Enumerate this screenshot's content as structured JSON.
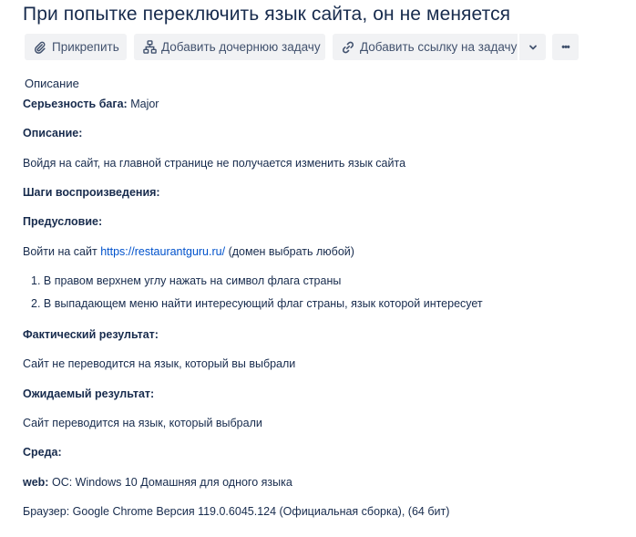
{
  "issue": {
    "title": "При попытке переключить язык сайта, он не меняется"
  },
  "toolbar": {
    "attach_label": "Прикрепить",
    "child_task_label": "Добавить дочернюю задачу",
    "link_task_label": "Добавить ссылку на задачу",
    "more_label": "•••"
  },
  "description": {
    "section_label": "Описание",
    "severity_label": "Серьезность бага:",
    "severity_value": "Major",
    "desc_heading": "Описание:",
    "desc_text": "Войдя на сайт, на главной странице не получается изменить язык сайта",
    "steps_heading": "Шаги воспроизведения:",
    "precondition_heading": "Предусловие:",
    "precondition_prefix": "Войти на сайт",
    "precondition_link": "https://restaurantguru.ru/",
    "precondition_suffix": "(домен выбрать любой)",
    "steps": [
      {
        "num": "1.",
        "text": "В правом верхнем углу нажать на символ флага страны"
      },
      {
        "num": "2.",
        "text": "В выпадающем меню найти интересующий флаг страны, язык которой интересует"
      }
    ],
    "actual_heading": "Фактический результат:",
    "actual_text": "Сайт не переводится на язык, который вы выбрали",
    "expected_heading": "Ожидаемый результат:",
    "expected_text": "Сайт переводится на язык, который выбрали",
    "env_heading": "Среда:",
    "env_web_label": "web:",
    "env_web_value": "ОС: Windows 10 Домашняя для одного языка",
    "env_browser": "Браузер: Google Chrome Версия 119.0.6045.124 (Официальная сборка), (64 бит)"
  }
}
